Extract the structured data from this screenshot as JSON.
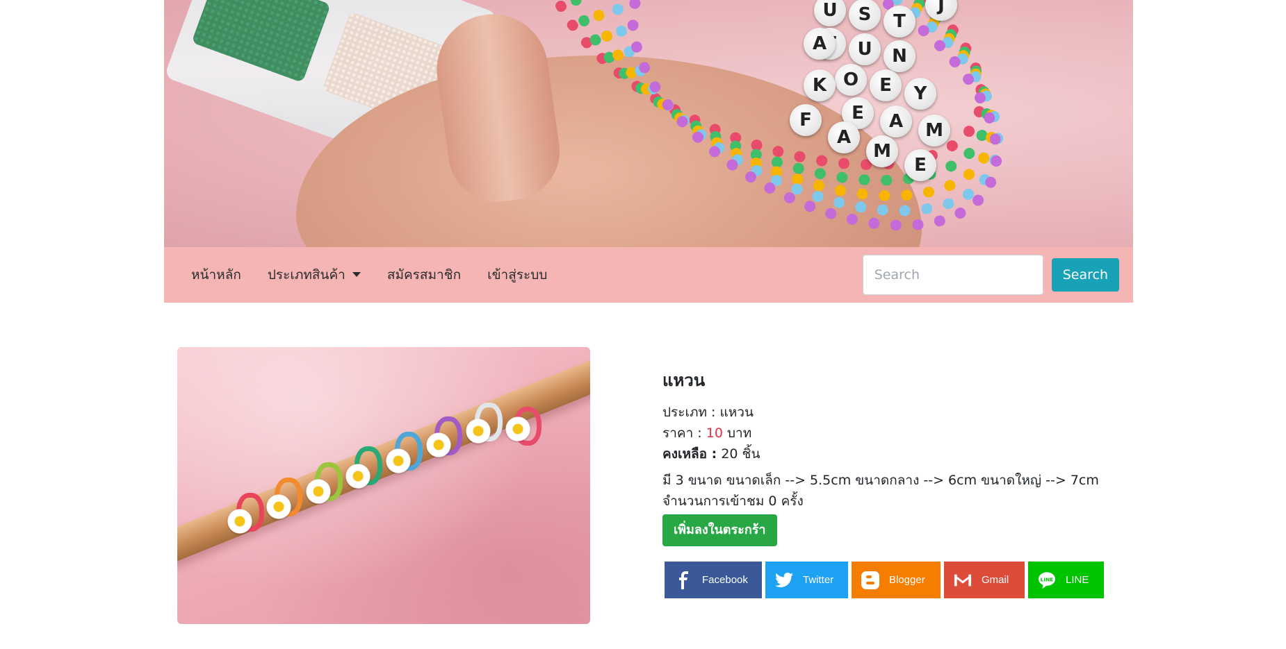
{
  "banner": {
    "bead_letters": [
      "J",
      "U",
      "S",
      "T",
      "T",
      "U",
      "N",
      "A",
      "O",
      "E",
      "Y",
      "K",
      "E",
      "A",
      "M",
      "F",
      "A",
      "M",
      "E"
    ]
  },
  "nav": {
    "items": [
      {
        "label": "หน้าหลัก"
      },
      {
        "label": "ประเภทสินค้า"
      },
      {
        "label": "สมัครสมาชิก"
      },
      {
        "label": "เข้าสู่ระบบ"
      }
    ],
    "search": {
      "placeholder": "Search",
      "value": "",
      "button_label": "Search"
    }
  },
  "product": {
    "name": "แหวน",
    "category_label": "ประเภท :",
    "category_value": "แหวน",
    "price_label": "ราคา :",
    "price_value": "10",
    "price_unit": "บาท",
    "stock_label": "คงเหลือ :",
    "stock_value": "20 ชิ้น",
    "description": "มี 3 ขนาด ขนาดเล็ก --> 5.5cm ขนาดกลาง --> 6cm ขนาดใหญ่ --> 7cm",
    "views_text": "จำนวนการเข้าชม 0 ครั้ง",
    "add_to_cart_label": "เพิ่มลงในตระกร้า"
  },
  "share": {
    "facebook": "Facebook",
    "twitter": "Twitter",
    "blogger": "Blogger",
    "gmail": "Gmail",
    "line": "LINE"
  },
  "colors": {
    "navbar": "#f4b5b4",
    "search_button": "#17a2b8",
    "add_to_cart": "#28a745",
    "price": "#dc3545",
    "facebook": "#3b5998",
    "twitter": "#1da1f2",
    "blogger": "#f57d00",
    "gmail": "#dd4b39",
    "line": "#00c300"
  }
}
